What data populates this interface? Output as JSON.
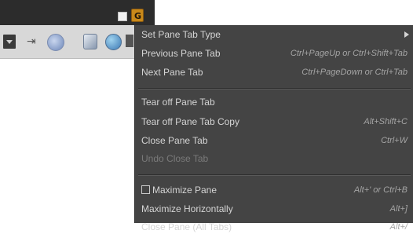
{
  "titlebar": {
    "restore_icon": "restore-square-icon",
    "app_icon_glyph": "G"
  },
  "toolbar": {
    "icons": [
      "dropdown-arrow-icon",
      "pin-icon",
      "circle-icon",
      "cube-icon",
      "globe-icon"
    ],
    "pin_glyph": "⇥"
  },
  "menu": {
    "items": [
      {
        "label": "Set Pane Tab Type",
        "shortcut": "",
        "submenu": true
      },
      {
        "label": "Previous Pane Tab",
        "shortcut": "Ctrl+PageUp or Ctrl+Shift+Tab"
      },
      {
        "label": "Next Pane Tab",
        "shortcut": "Ctrl+PageDown or Ctrl+Tab"
      },
      {
        "label": "Tear off Pane Tab",
        "shortcut": ""
      },
      {
        "label": "Tear off Pane Tab Copy",
        "shortcut": "Alt+Shift+C"
      },
      {
        "label": "Close Pane Tab",
        "shortcut": "Ctrl+W"
      },
      {
        "label": "Undo Close Tab",
        "shortcut": "",
        "disabled": true
      },
      {
        "label": "Maximize Pane",
        "shortcut": "Alt+' or Ctrl+B",
        "checkbox": true
      },
      {
        "label": "Maximize Horizontally",
        "shortcut": "Alt+]"
      },
      {
        "label": "Close Pane (All Tabs)",
        "shortcut": "Alt+/"
      }
    ]
  }
}
